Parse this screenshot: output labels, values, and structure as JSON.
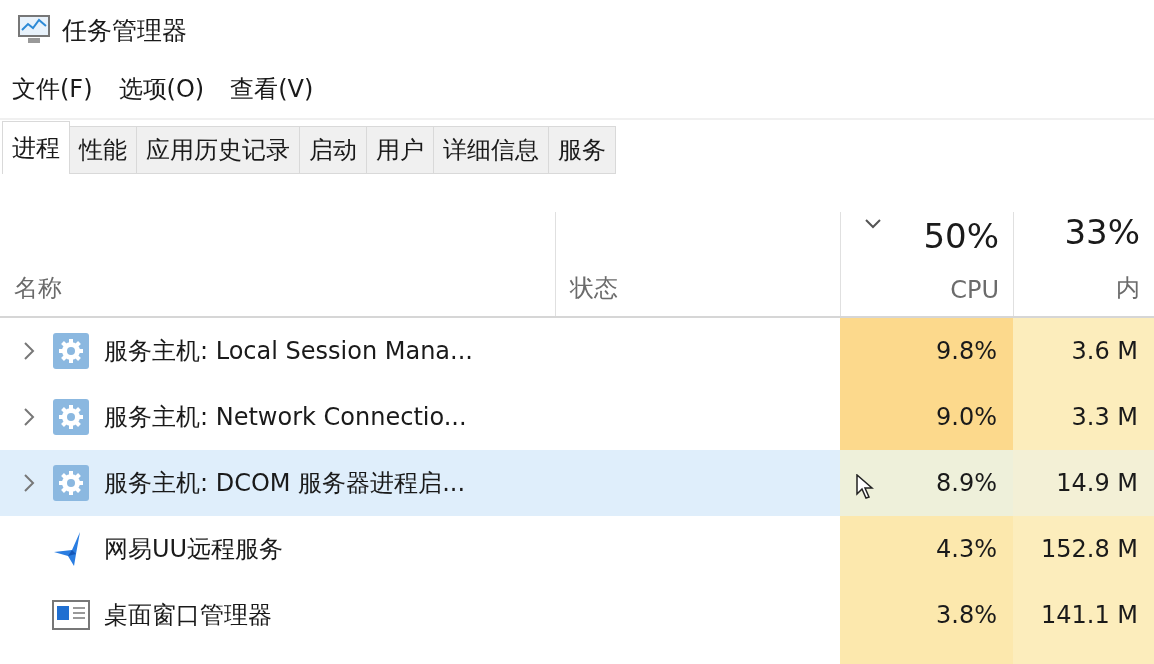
{
  "window": {
    "title": "任务管理器"
  },
  "menu": [
    "文件(F)",
    "选项(O)",
    "查看(V)"
  ],
  "tabs": [
    {
      "label": "进程",
      "selected": true
    },
    {
      "label": "性能",
      "selected": false
    },
    {
      "label": "应用历史记录",
      "selected": false
    },
    {
      "label": "启动",
      "selected": false
    },
    {
      "label": "用户",
      "selected": false
    },
    {
      "label": "详细信息",
      "selected": false
    },
    {
      "label": "服务",
      "selected": false
    }
  ],
  "columns": {
    "name": {
      "label": "名称"
    },
    "status": {
      "label": "状态"
    },
    "cpu": {
      "percent": "50%",
      "label": "CPU",
      "sorted": true
    },
    "memory": {
      "percent": "33%",
      "label": "内"
    }
  },
  "rows": [
    {
      "name": "服务主机: Local Session Mana...",
      "kind": "gear",
      "expandable": true,
      "selected": false,
      "cpu": "9.8%",
      "memory": "3.6 M",
      "color": "#fcd98c"
    },
    {
      "name": "服务主机: Network Connectio...",
      "kind": "gear",
      "expandable": true,
      "selected": false,
      "cpu": "9.0%",
      "memory": "3.3 M",
      "color": "#fcd98c"
    },
    {
      "name": "服务主机: DCOM 服务器进程启...",
      "kind": "gear",
      "expandable": true,
      "selected": true,
      "cpu": "8.9%",
      "memory": "14.9 M",
      "color": "#eef0da"
    },
    {
      "name": "网易UU远程服务",
      "kind": "star",
      "expandable": false,
      "selected": false,
      "cpu": "4.3%",
      "memory": "152.8 M",
      "color": "#fce8ad"
    },
    {
      "name": "桌面窗口管理器",
      "kind": "window",
      "expandable": false,
      "selected": false,
      "cpu": "3.8%",
      "memory": "141.1 M",
      "color": "#fce8ad"
    }
  ]
}
